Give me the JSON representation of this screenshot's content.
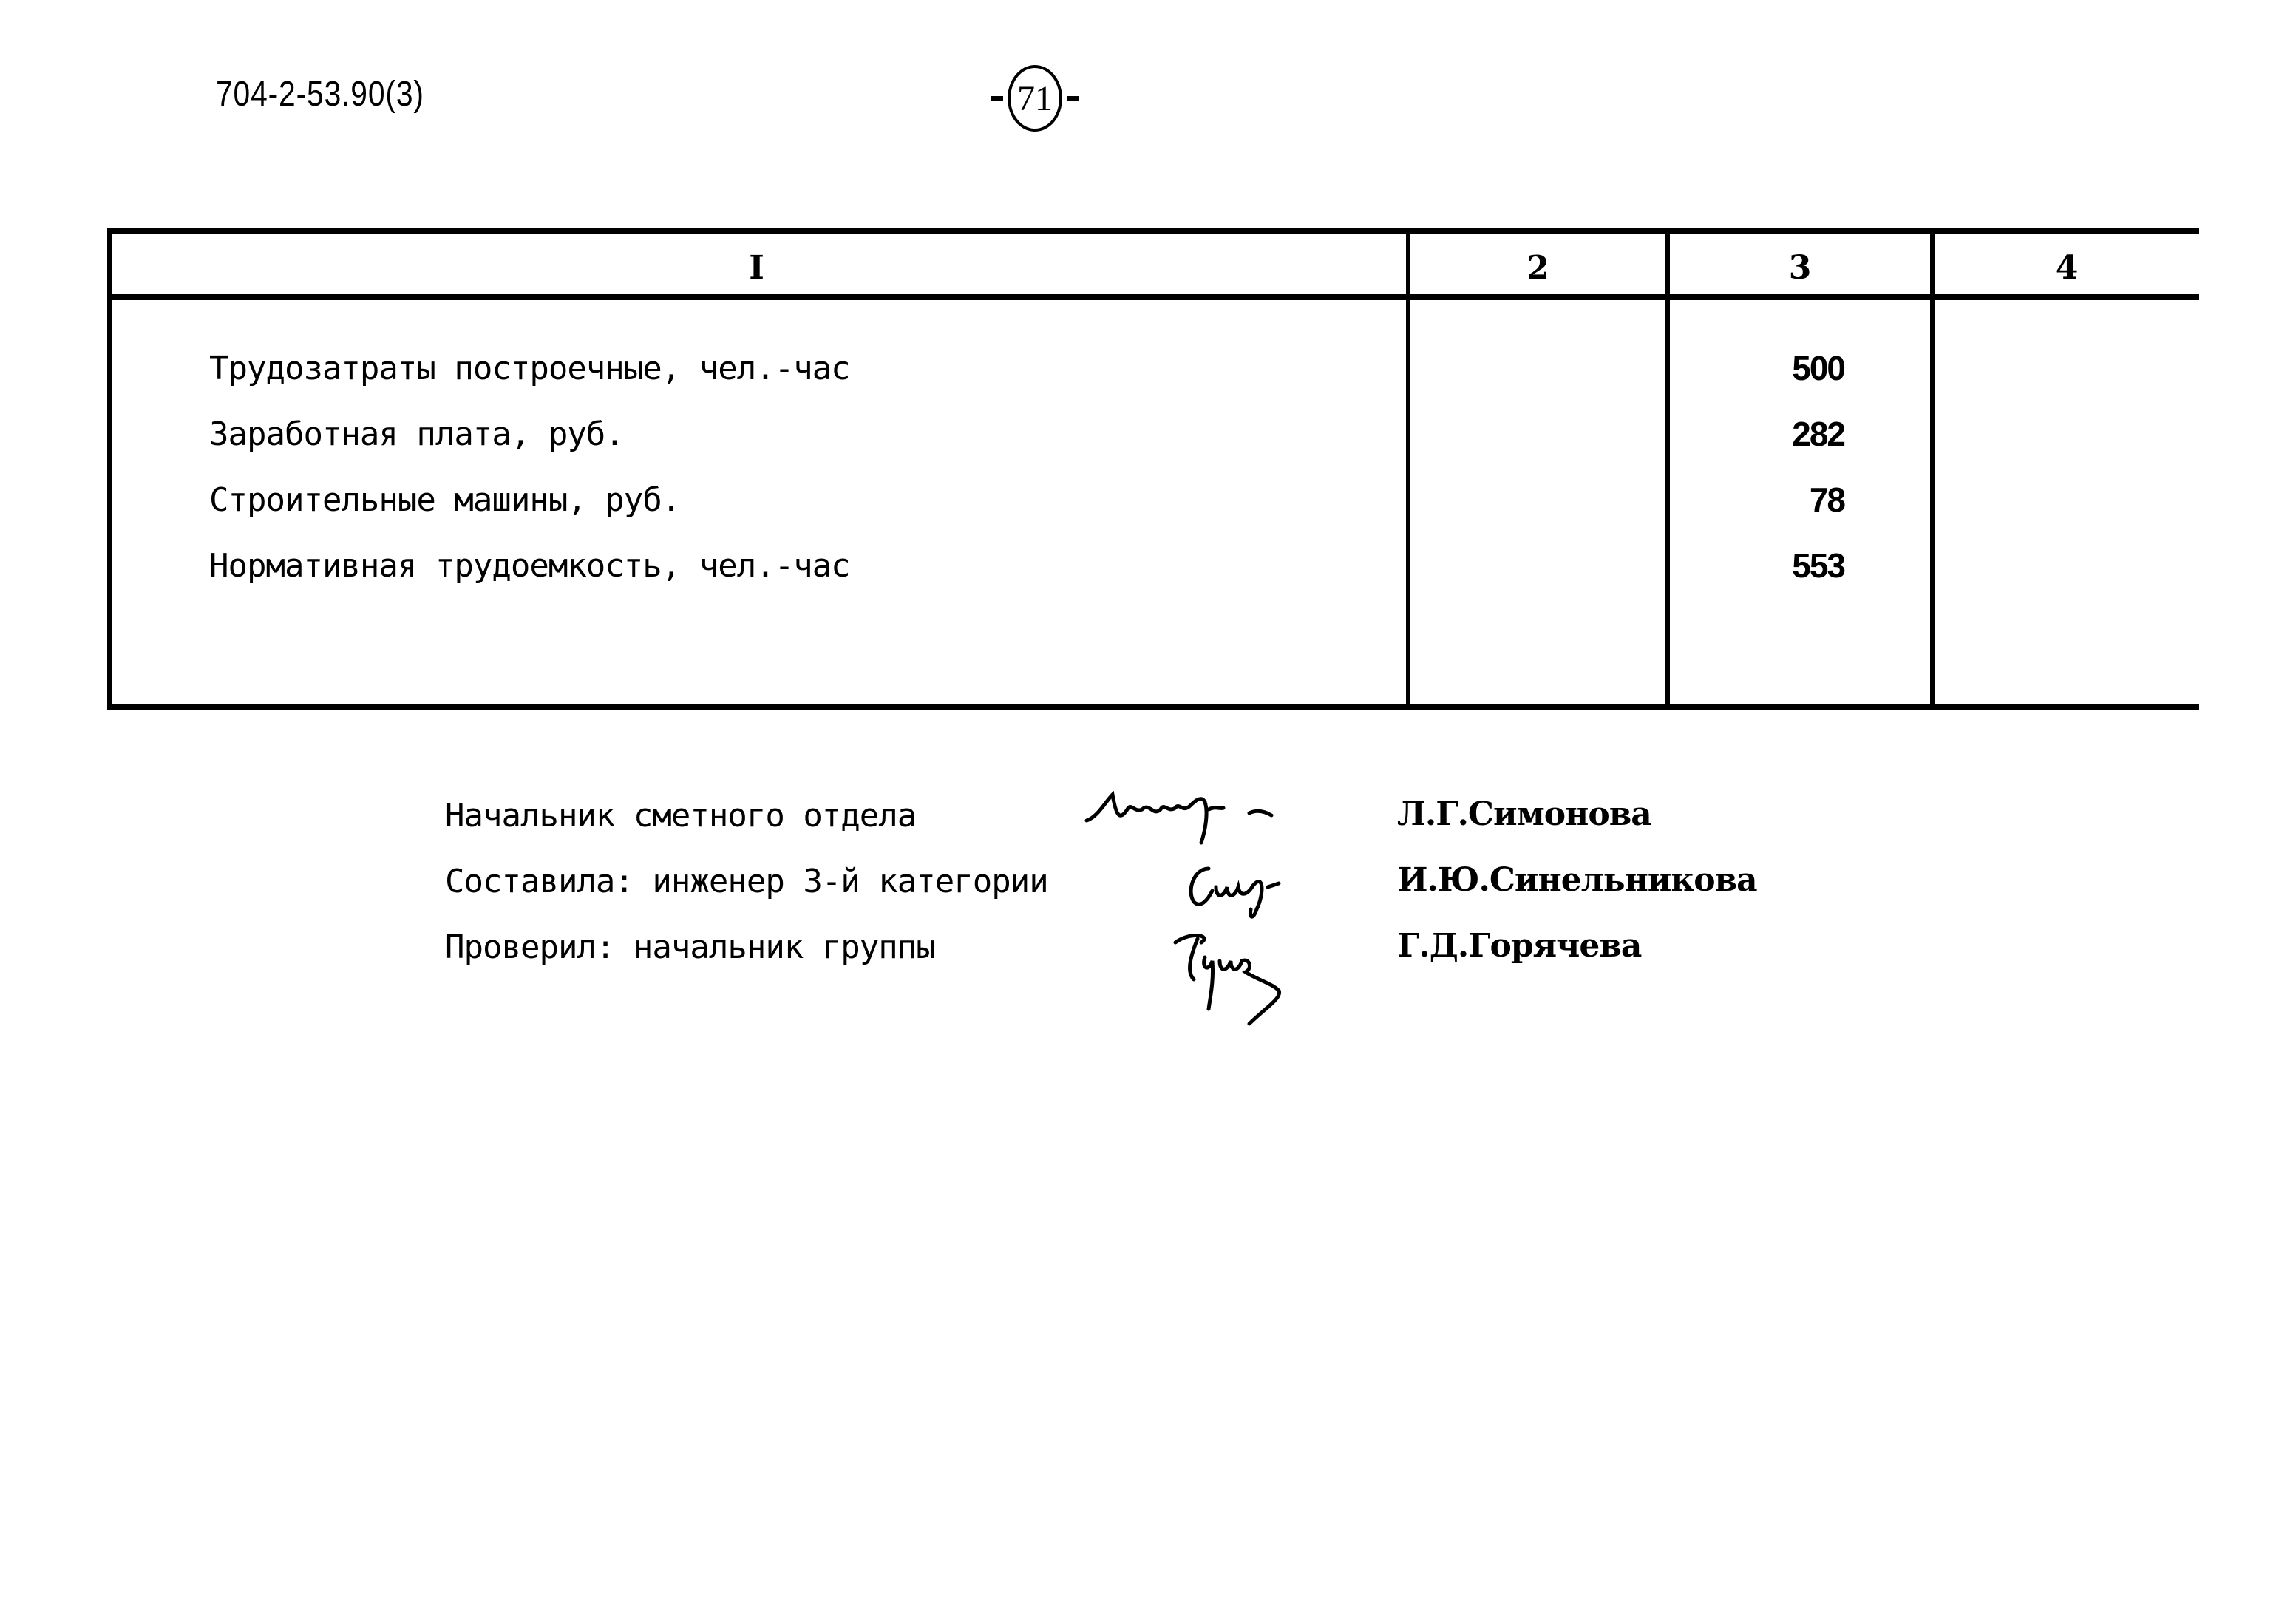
{
  "header": {
    "document_code": "704-2-53.90(3)",
    "page_number": "71"
  },
  "table": {
    "columns": [
      "I",
      "2",
      "3",
      "4"
    ],
    "rows": [
      {
        "label": "Трудозатраты построечные, чел.-час",
        "col2": "",
        "col3": "500",
        "col4": ""
      },
      {
        "label": "Заработная плата, руб.",
        "col2": "",
        "col3": "282",
        "col4": ""
      },
      {
        "label": "Строительные машины, руб.",
        "col2": "",
        "col3": "78",
        "col4": ""
      },
      {
        "label": "Нормативная трудоемкость, чел.-час",
        "col2": "",
        "col3": "553",
        "col4": ""
      }
    ]
  },
  "signatures": [
    {
      "role": "Начальник сметного отдела",
      "name": "Л.Г.Симонова",
      "signature_icon": "handwritten-signature"
    },
    {
      "role": "Составила: инженер 3-й категории",
      "name": "И.Ю.Синельникова",
      "signature_icon": "handwritten-signature"
    },
    {
      "role": "Проверил: начальник группы",
      "name": "Г.Д.Горячева",
      "signature_icon": "handwritten-signature"
    }
  ]
}
